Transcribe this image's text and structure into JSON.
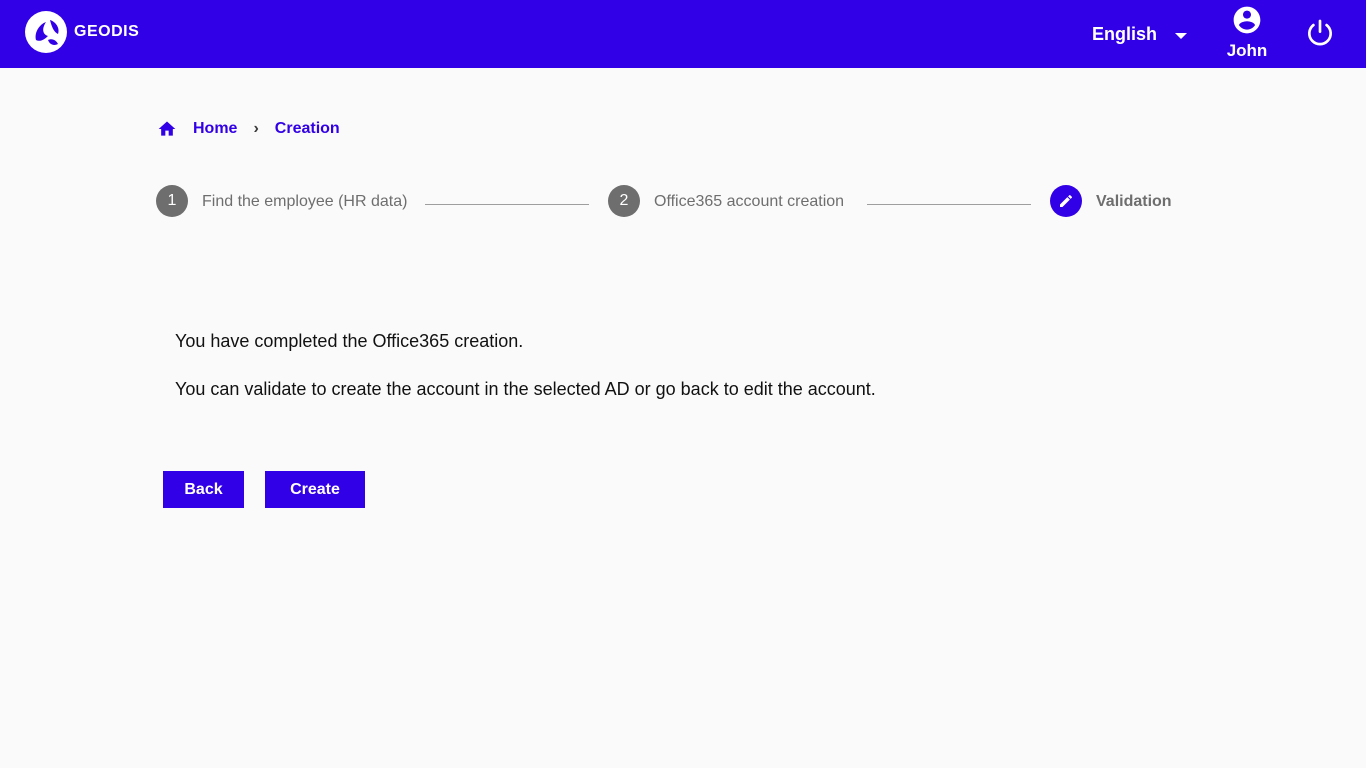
{
  "header": {
    "brand": "GEODIS",
    "language": "English",
    "user_name": "John",
    "icons": {
      "logo": "geodis-logo",
      "language_dropdown": "caret-down-icon",
      "user": "account-circle-icon",
      "logout": "power-icon"
    }
  },
  "breadcrumb": {
    "home": "Home",
    "separator": "›",
    "current": "Creation"
  },
  "stepper": {
    "steps": [
      {
        "number": "1",
        "label": "Find the employee (HR data)",
        "state": "done"
      },
      {
        "number": "2",
        "label": "Office365 account creation",
        "state": "done"
      },
      {
        "number": "",
        "label": "Validation",
        "state": "active",
        "icon": "pencil-icon"
      }
    ]
  },
  "content": {
    "line1": "You have completed the Office365 creation.",
    "line2": "You can validate to create the account in the selected AD or go back to edit the account."
  },
  "actions": {
    "back": "Back",
    "create": "Create"
  },
  "colors": {
    "primary": "#3200e6",
    "step_inactive": "#6e6e6e",
    "background": "#fafafa"
  }
}
